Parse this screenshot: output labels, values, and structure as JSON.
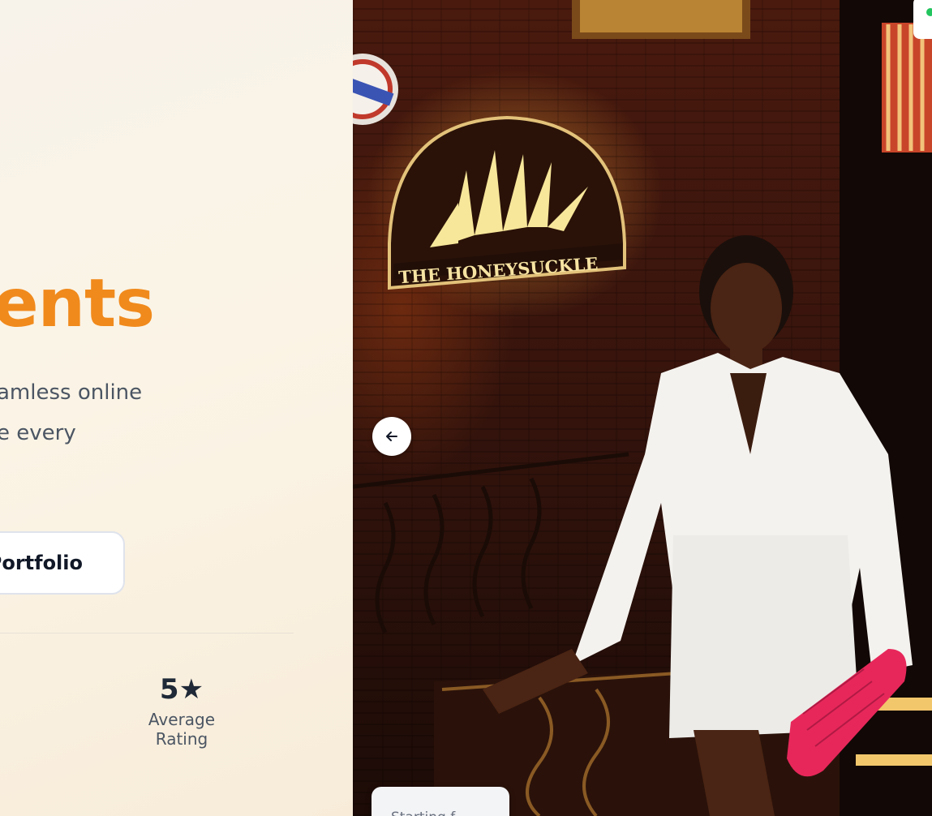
{
  "hero": {
    "headline_fragment": "ents",
    "description_line1": "amless online",
    "description_line2": "e every",
    "portfolio_button": "Portfolio"
  },
  "stats": {
    "rating_value": "5★",
    "rating_label": "Average Rating"
  },
  "gallery": {
    "sign_text": "THE HONEYSUCKLE",
    "bottom_card_text": "Starting f"
  },
  "colors": {
    "accent": "#f08a1c",
    "text_dark": "#1f2937",
    "text_muted": "#4b5563",
    "status_dot": "#22c55e"
  },
  "icons": {
    "prev": "arrow-left-icon"
  }
}
